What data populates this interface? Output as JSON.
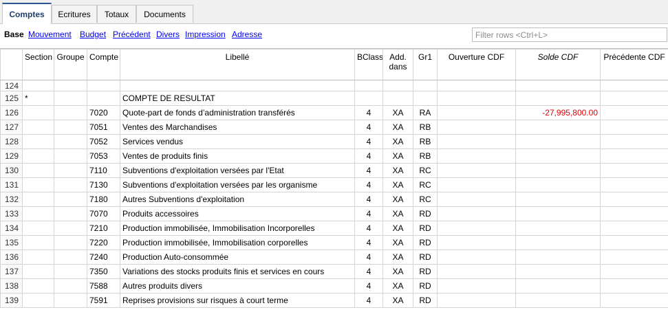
{
  "tabs": [
    {
      "label": "Comptes",
      "active": true
    },
    {
      "label": "Ecritures",
      "active": false
    },
    {
      "label": "Totaux",
      "active": false
    },
    {
      "label": "Documents",
      "active": false
    }
  ],
  "views": [
    {
      "label": "Base",
      "active": true
    },
    {
      "label": "Mouvement",
      "active": false
    },
    {
      "label": "Budget",
      "active": false
    },
    {
      "label": "Précédent",
      "active": false
    },
    {
      "label": "Divers",
      "active": false
    },
    {
      "label": "Impression",
      "active": false
    },
    {
      "label": "Adresse",
      "active": false
    }
  ],
  "filter": {
    "placeholder": "Filter rows <Ctrl+L>",
    "value": ""
  },
  "columns": {
    "row": "",
    "section": "Section",
    "groupe": "Groupe",
    "compte": "Compte",
    "libelle": "Libellé",
    "bclasse": "BClasse",
    "add_dans_1": "Add.",
    "add_dans_2": "dans",
    "gr1": "Gr1",
    "ouverture": "Ouverture CDF",
    "solde": "Solde CDF",
    "precedente": "Précédente CDF"
  },
  "rows": [
    {
      "n": "124",
      "section": "",
      "groupe": "",
      "compte": "",
      "libelle": "",
      "bclasse": "",
      "add": "",
      "gr1": "",
      "ouverture": "",
      "solde": "",
      "precedente": ""
    },
    {
      "n": "125",
      "section": "*",
      "groupe": "",
      "compte": "",
      "libelle": "COMPTE DE RESULTAT",
      "bclasse": "",
      "add": "",
      "gr1": "",
      "ouverture": "",
      "solde": "",
      "precedente": ""
    },
    {
      "n": "126",
      "section": "",
      "groupe": "",
      "compte": "7020",
      "libelle": "Quote-part de fonds d’administration transférés",
      "bclasse": "4",
      "add": "XA",
      "gr1": "RA",
      "ouverture": "",
      "solde": "-27,995,800.00",
      "precedente": ""
    },
    {
      "n": "127",
      "section": "",
      "groupe": "",
      "compte": "7051",
      "libelle": "Ventes des Marchandises",
      "bclasse": "4",
      "add": "XA",
      "gr1": "RB",
      "ouverture": "",
      "solde": "",
      "precedente": ""
    },
    {
      "n": "128",
      "section": "",
      "groupe": "",
      "compte": "7052",
      "libelle": "Services vendus",
      "bclasse": "4",
      "add": "XA",
      "gr1": "RB",
      "ouverture": "",
      "solde": "",
      "precedente": ""
    },
    {
      "n": "129",
      "section": "",
      "groupe": "",
      "compte": "7053",
      "libelle": "Ventes de produits finis",
      "bclasse": "4",
      "add": "XA",
      "gr1": "RB",
      "ouverture": "",
      "solde": "",
      "precedente": ""
    },
    {
      "n": "130",
      "section": "",
      "groupe": "",
      "compte": "7110",
      "libelle": "Subventions d'exploitation versées par l'Etat",
      "bclasse": "4",
      "add": "XA",
      "gr1": "RC",
      "ouverture": "",
      "solde": "",
      "precedente": ""
    },
    {
      "n": "131",
      "section": "",
      "groupe": "",
      "compte": "7130",
      "libelle": "Subventions d'exploitation versées par les organisme",
      "bclasse": "4",
      "add": "XA",
      "gr1": "RC",
      "ouverture": "",
      "solde": "",
      "precedente": ""
    },
    {
      "n": "132",
      "section": "",
      "groupe": "",
      "compte": "7180",
      "libelle": "Autres Subventions d'exploitation",
      "bclasse": "4",
      "add": "XA",
      "gr1": "RC",
      "ouverture": "",
      "solde": "",
      "precedente": ""
    },
    {
      "n": "133",
      "section": "",
      "groupe": "",
      "compte": "7070",
      "libelle": "Produits accessoires",
      "bclasse": "4",
      "add": "XA",
      "gr1": "RD",
      "ouverture": "",
      "solde": "",
      "precedente": ""
    },
    {
      "n": "134",
      "section": "",
      "groupe": "",
      "compte": "7210",
      "libelle": "Production immobilisée, Immobilisation Incorporelles",
      "bclasse": "4",
      "add": "XA",
      "gr1": "RD",
      "ouverture": "",
      "solde": "",
      "precedente": ""
    },
    {
      "n": "135",
      "section": "",
      "groupe": "",
      "compte": "7220",
      "libelle": "Production immobilisée, Immobilisation  corporelles",
      "bclasse": "4",
      "add": "XA",
      "gr1": "RD",
      "ouverture": "",
      "solde": "",
      "precedente": ""
    },
    {
      "n": "136",
      "section": "",
      "groupe": "",
      "compte": "7240",
      "libelle": "Production Auto-consommée",
      "bclasse": "4",
      "add": "XA",
      "gr1": "RD",
      "ouverture": "",
      "solde": "",
      "precedente": ""
    },
    {
      "n": "137",
      "section": "",
      "groupe": "",
      "compte": "7350",
      "libelle": "Variations des stocks produits finis et services en cours",
      "bclasse": "4",
      "add": "XA",
      "gr1": "RD",
      "ouverture": "",
      "solde": "",
      "precedente": ""
    },
    {
      "n": "138",
      "section": "",
      "groupe": "",
      "compte": "7588",
      "libelle": "Autres produits divers",
      "bclasse": "4",
      "add": "XA",
      "gr1": "RD",
      "ouverture": "",
      "solde": "",
      "precedente": ""
    },
    {
      "n": "139",
      "section": "",
      "groupe": "",
      "compte": "7591",
      "libelle": "Reprises provisions sur risques à court terme",
      "bclasse": "4",
      "add": "XA",
      "gr1": "RD",
      "ouverture": "",
      "solde": "",
      "precedente": ""
    }
  ],
  "colors": {
    "accent": "#2b5797",
    "negative": "#e00000",
    "link": "#0000ee"
  }
}
